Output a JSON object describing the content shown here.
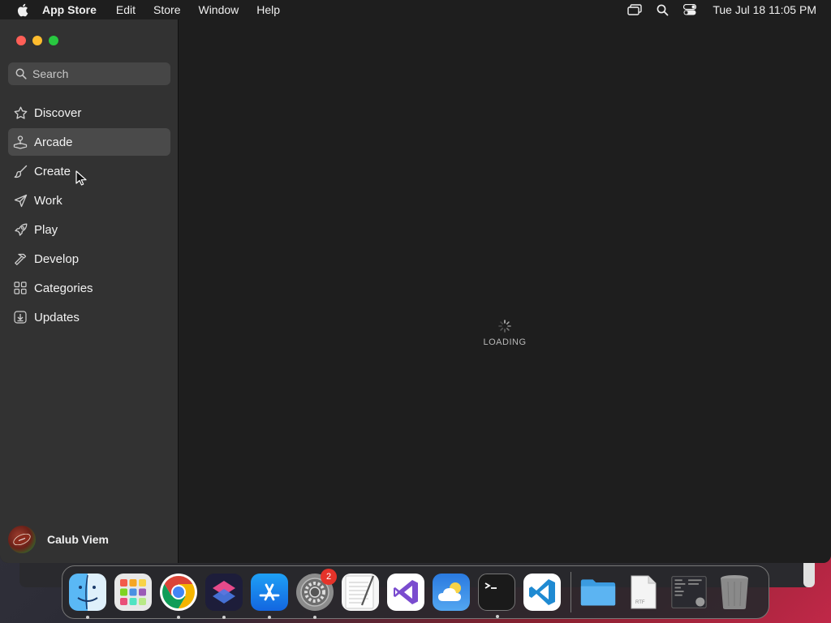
{
  "menubar": {
    "app_name": "App Store",
    "menus": [
      "Edit",
      "Store",
      "Window",
      "Help"
    ],
    "clock": "Tue Jul 18  11:05 PM"
  },
  "sidebar": {
    "search_placeholder": "Search",
    "items": [
      {
        "label": "Discover",
        "icon": "star-icon"
      },
      {
        "label": "Arcade",
        "icon": "joystick-icon",
        "selected": true
      },
      {
        "label": "Create",
        "icon": "paintbrush-icon"
      },
      {
        "label": "Work",
        "icon": "paper-plane-icon"
      },
      {
        "label": "Play",
        "icon": "rocket-icon"
      },
      {
        "label": "Develop",
        "icon": "hammer-icon"
      },
      {
        "label": "Categories",
        "icon": "grid-icon"
      },
      {
        "label": "Updates",
        "icon": "download-icon"
      }
    ],
    "user_name": "Calub Viem"
  },
  "content": {
    "loading_text": "LOADING"
  },
  "dock": {
    "apps": [
      {
        "name": "Finder",
        "running": true
      },
      {
        "name": "Launchpad",
        "running": false
      },
      {
        "name": "Google Chrome",
        "running": true
      },
      {
        "name": "Shortcuts",
        "running": true
      },
      {
        "name": "App Store",
        "running": true
      },
      {
        "name": "System Settings",
        "running": true,
        "badge": "2"
      },
      {
        "name": "TextEdit",
        "running": false
      },
      {
        "name": "Visual Studio",
        "running": false
      },
      {
        "name": "Weather",
        "running": false
      },
      {
        "name": "Terminal",
        "running": true
      },
      {
        "name": "Visual Studio Code",
        "running": false
      }
    ],
    "badge_settings": "2",
    "rtf_label": "RTF"
  },
  "colors": {
    "selected_bg": "#4a4a4a",
    "sidebar_bg": "#323232",
    "content_bg": "#1e1e1e",
    "close": "#ff5f57",
    "minimize": "#febc2e",
    "maximize": "#28c840",
    "badge": "#e5332a"
  }
}
